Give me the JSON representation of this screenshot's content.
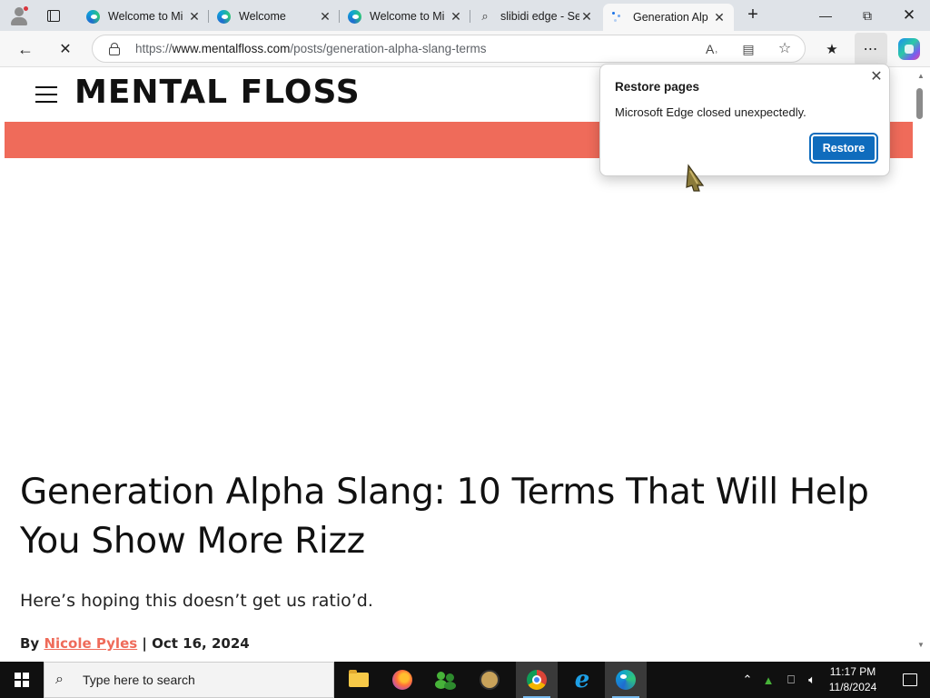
{
  "browser": {
    "tabs": [
      {
        "title": "Welcome to Mi",
        "favicon": "edge-icon",
        "active": false
      },
      {
        "title": "Welcome",
        "favicon": "edge-icon",
        "active": false
      },
      {
        "title": "Welcome to Mi",
        "favicon": "edge-icon",
        "active": false
      },
      {
        "title": "slibidi edge - Se",
        "favicon": "search-icon",
        "active": false
      },
      {
        "title": "Generation Alp",
        "favicon": "loading-icon",
        "active": true
      }
    ],
    "address": {
      "url_prefix": "https://",
      "url_host": "www.mentalfloss.com",
      "url_path": "/posts/generation-alpha-slang-terms"
    }
  },
  "page": {
    "site_name": "MENTAL FLOSS",
    "promo_color": "#ef6b5a",
    "headline": "Generation Alpha Slang: 10 Terms That Will Help You Show More Rizz",
    "subhead": "Here’s hoping this doesn’t get us ratio’d.",
    "byline": {
      "prefix": "By",
      "author": "Nicole Pyles",
      "separator": "|",
      "date": "Oct 16, 2024"
    }
  },
  "popup": {
    "title": "Restore pages",
    "message": "Microsoft Edge closed unexpectedly.",
    "button": "Restore"
  },
  "taskbar": {
    "search_placeholder": "Type here to search",
    "time": "11:17 PM",
    "date": "11/8/2024"
  }
}
